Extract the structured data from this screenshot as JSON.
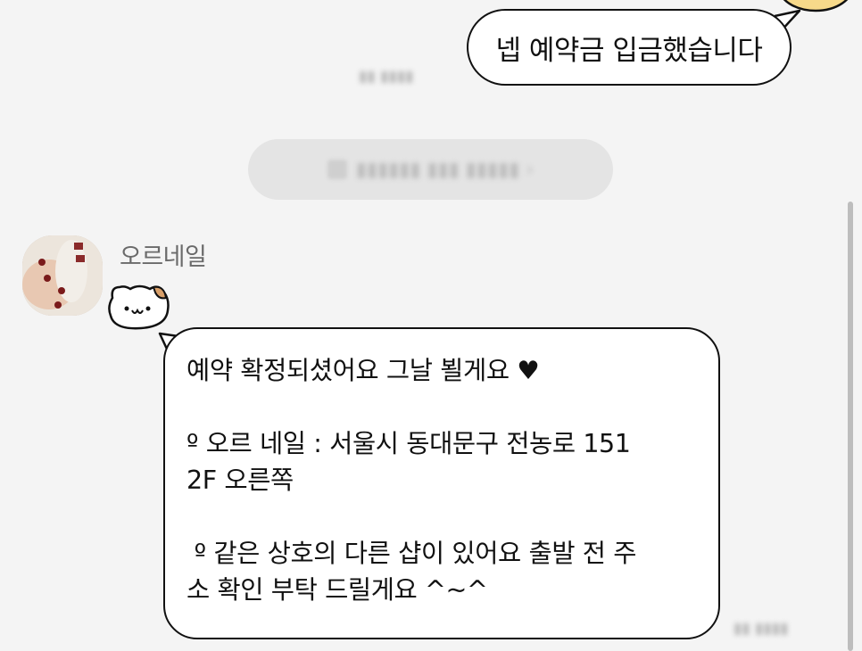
{
  "outgoing": {
    "text": "넵 예약금 입금했습니다"
  },
  "incoming": {
    "sender": "오르네일",
    "lines": [
      "예약 확정되셨어요 그날 뵐게요 ♥",
      "",
      "º 오르 네일 : 서울시 동대문구 전농로 151",
      "2F 오른쪽",
      "",
      " º 같은 상호의 다른 샵이 있어요 출발 전 주",
      "소 확인 부탁 드릴게요 ^~^"
    ]
  },
  "colors": {
    "background": "#f4f4f4",
    "bubble": "#ffffff",
    "bubble_border": "#111111",
    "sender_name": "#6a6a6a",
    "blurred_pill": "#e4e4e4",
    "scrollbar": "#bdbdbd"
  },
  "icons": [
    "character-sticker-icon",
    "cat-emoticon-icon",
    "avatar"
  ]
}
